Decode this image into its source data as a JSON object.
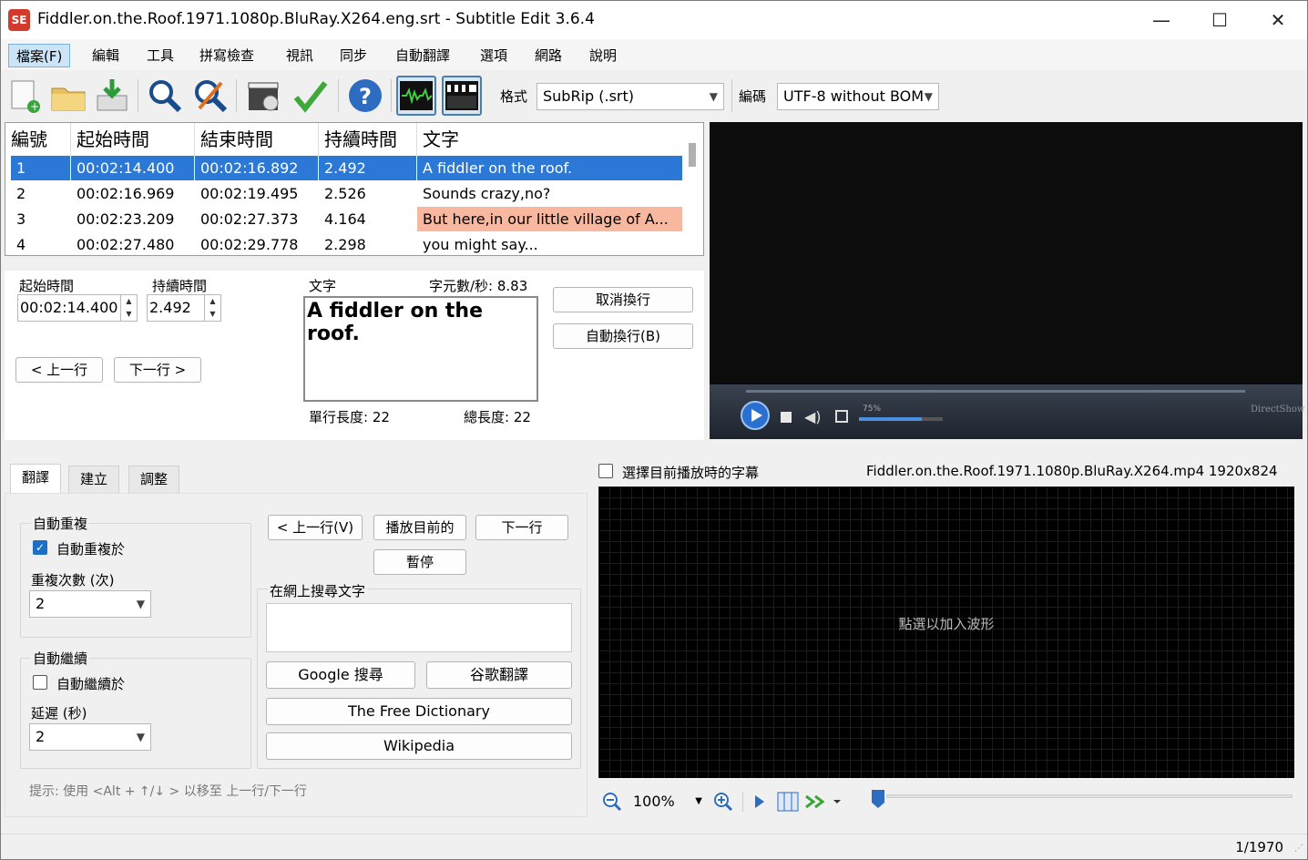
{
  "window": {
    "title": "Fiddler.on.the.Roof.1971.1080p.BluRay.X264.eng.srt - Subtitle Edit 3.6.4",
    "icon_text": "SE",
    "minimize": "—",
    "maximize": "☐",
    "close": "✕"
  },
  "menu": [
    "檔案(F)",
    "編輯",
    "工具",
    "拼寫檢查",
    "視訊",
    "同步",
    "自動翻譯",
    "選項",
    "網路",
    "說明"
  ],
  "toolbar": {
    "format_label": "格式",
    "format_value": "SubRip (.srt)",
    "encoding_label": "編碼",
    "encoding_value": "UTF-8 without BOM"
  },
  "subtitle_list": {
    "headers": [
      "編號",
      "起始時間",
      "結束時間",
      "持續時間",
      "文字"
    ],
    "rows": [
      {
        "num": "1",
        "start": "00:02:14.400",
        "end": "00:02:16.892",
        "dur": "2.492",
        "text": "A fiddler on the roof."
      },
      {
        "num": "2",
        "start": "00:02:16.969",
        "end": "00:02:19.495",
        "dur": "2.526",
        "text": "Sounds crazy,no?"
      },
      {
        "num": "3",
        "start": "00:02:23.209",
        "end": "00:02:27.373",
        "dur": "4.164",
        "text": "But here,in our little village of A..."
      },
      {
        "num": "4",
        "start": "00:02:27.480",
        "end": "00:02:29.778",
        "dur": "2.298",
        "text": "you might say..."
      }
    ]
  },
  "editor": {
    "start_label": "起始時間",
    "start_value": "00:02:14.400",
    "duration_label": "持續時間",
    "duration_value": "2.492",
    "text_label": "文字",
    "cps_label": "字元數/秒: 8.83",
    "text_value": "A fiddler on the roof.",
    "single_line_len": "單行長度: 22",
    "total_len": "總長度: 22",
    "prev_button": "< 上一行",
    "next_button": "下一行 >",
    "unbreak_button": "取消換行",
    "autobreak_button": "自動換行(B)"
  },
  "video": {
    "volume_label": "75%",
    "engine_label": "DirectShow"
  },
  "tabs": [
    "翻譯",
    "建立",
    "調整"
  ],
  "translate_tab": {
    "auto_repeat_group": "自動重複",
    "auto_repeat_check": "自動重複於",
    "repeat_count_label": "重複次數 (次)",
    "repeat_count_value": "2",
    "auto_continue_group": "自動繼續",
    "auto_continue_check": "自動繼續於",
    "delay_label": "延遲 (秒)",
    "delay_value": "2",
    "prev_button": "< 上一行(V)",
    "play_current_button": "播放目前的",
    "next_button": "下一行",
    "pause_button": "暫停",
    "search_label": "在網上搜尋文字",
    "search_value": "",
    "google_search": "Google 搜尋",
    "google_translate": "谷歌翻譯",
    "free_dictionary": "The Free Dictionary",
    "wikipedia": "Wikipedia",
    "hint": "提示: 使用 <Alt + ↑/↓ > 以移至 上一行/下一行"
  },
  "waveform": {
    "select_current_check": "選擇目前播放時的字幕",
    "video_info": "Fiddler.on.the.Roof.1971.1080p.BluRay.X264.mp4 1920x824",
    "placeholder": "點選以加入波形",
    "zoom_value": "100%"
  },
  "status": {
    "position": "1/1970"
  }
}
